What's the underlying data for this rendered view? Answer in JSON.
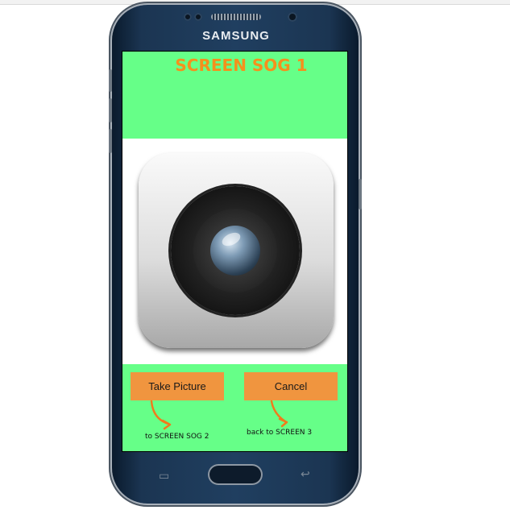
{
  "device": {
    "brand": "SAMSUNG"
  },
  "screen": {
    "title": "SCREEN SOG 1",
    "image": {
      "icon": "camera-icon"
    },
    "buttons": {
      "take_picture": "Take Picture",
      "cancel": "Cancel"
    },
    "nav_notes": {
      "take_picture_target": "to SCREEN SOG 2",
      "cancel_target": "back to SCREEN 3"
    }
  },
  "colors": {
    "screen_background": "#66ff88",
    "title_color": "#f5901c",
    "button_color": "#f0953f",
    "arrow_color": "#f07a1c"
  }
}
